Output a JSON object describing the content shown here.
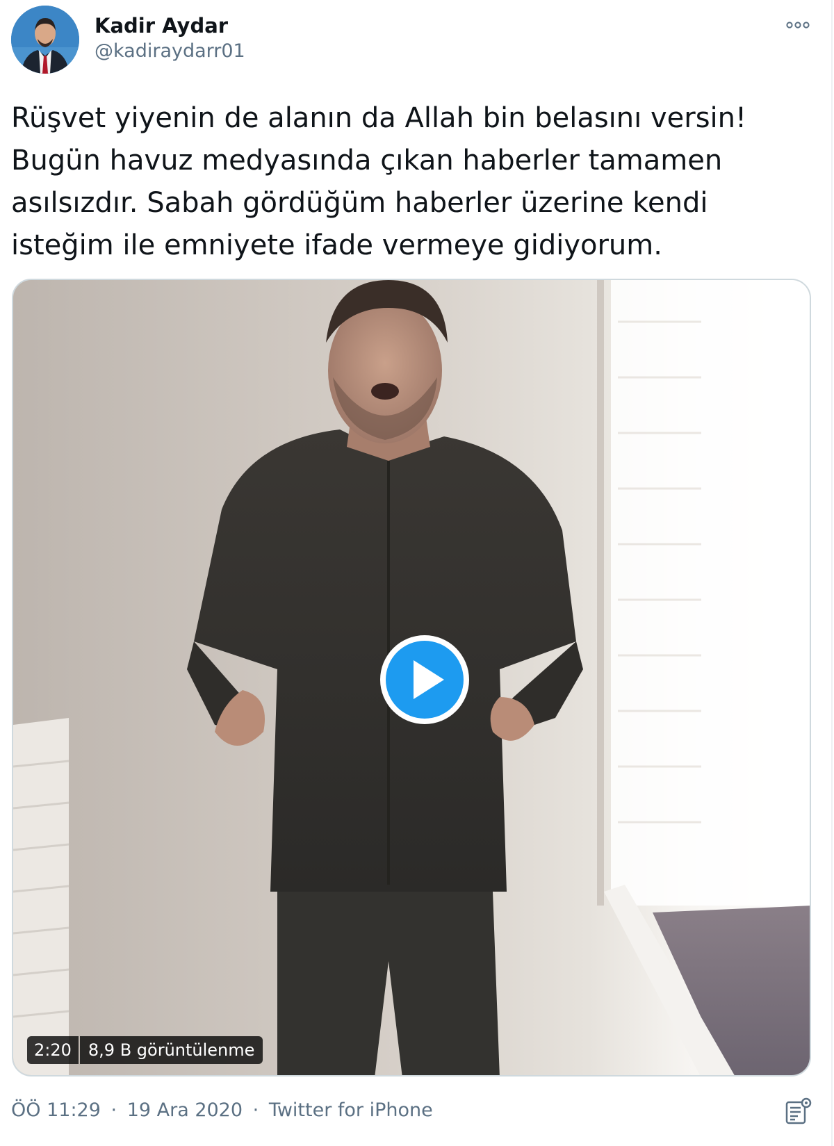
{
  "author": {
    "name": "Kadir Aydar",
    "handle": "@kadiraydarr01",
    "avatar_icon": "profile-photo"
  },
  "tweet": {
    "text": "Rüşvet yiyenin de alanın da Allah bin belasını versin!\nBugün havuz medyasında çıkan haberler tamamen\nasılsızdır. Sabah gördüğüm haberler üzerine kendi\nisteğim ile emniyete ifade vermeye gidiyorum."
  },
  "media": {
    "type": "video",
    "duration": "2:20",
    "views": "8,9 B görüntülenme",
    "play_icon": "play-icon"
  },
  "meta": {
    "time": "ÖÖ 11:29",
    "date": "19 Ara 2020",
    "source": "Twitter for iPhone",
    "separator": "·"
  },
  "icons": {
    "more": "more-options-icon",
    "analytics": "analytics-icon"
  },
  "colors": {
    "accent": "#1da1f2",
    "secondary_text": "#5b7083",
    "border": "#cfd9de"
  }
}
